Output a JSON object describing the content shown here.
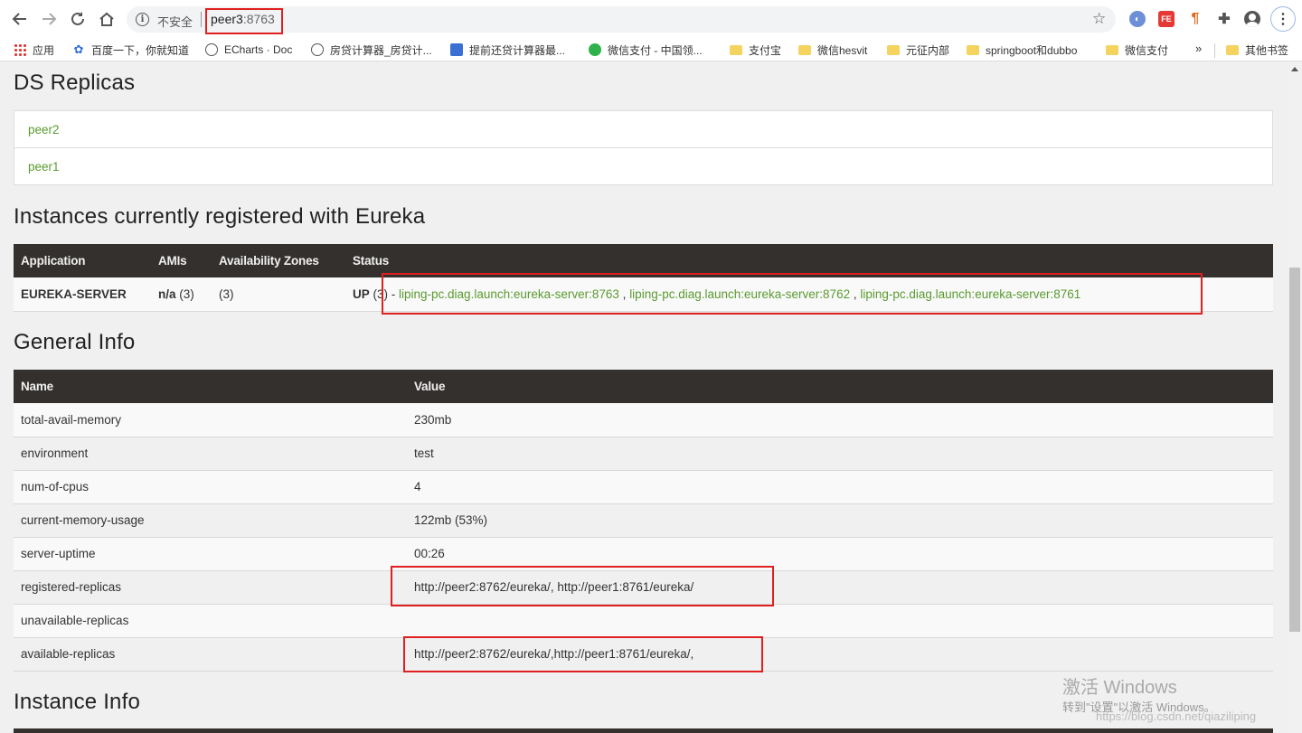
{
  "browser": {
    "security_label": "不安全",
    "url_host": "peer3",
    "url_port": ":8763",
    "menu_icon": "⋮"
  },
  "bookmarks": [
    {
      "label": "应用",
      "icon": "apps-icon"
    },
    {
      "label": "百度一下，你就知道",
      "icon": "paw-icon"
    },
    {
      "label": "ECharts · Doc",
      "icon": "globe-icon"
    },
    {
      "label": "房贷计算器_房贷计...",
      "icon": "globe-icon"
    },
    {
      "label": "提前还贷计算器最...",
      "icon": "bookmark-blue-icon"
    },
    {
      "label": "微信支付 - 中国领...",
      "icon": "wechat-icon"
    },
    {
      "label": "支付宝",
      "icon": "folder-icon"
    },
    {
      "label": "微信hesvit",
      "icon": "folder-icon"
    },
    {
      "label": "元征内部",
      "icon": "folder-icon"
    },
    {
      "label": "springboot和dubbo",
      "icon": "folder-icon"
    },
    {
      "label": "微信支付",
      "icon": "folder-icon"
    },
    {
      "label": "其他书签",
      "icon": "folder-icon"
    }
  ],
  "bookmarks_more": "»",
  "ds_replicas": {
    "title": "DS Replicas",
    "items": [
      "peer2",
      "peer1"
    ]
  },
  "instances": {
    "title": "Instances currently registered with Eureka",
    "headers": [
      "Application",
      "AMIs",
      "Availability Zones",
      "Status"
    ],
    "row": {
      "application": "EUREKA-SERVER",
      "amis_bold": "n/a",
      "amis_count": " (3)",
      "zones": "(3)",
      "status_up": "UP",
      "status_count": " (3) - ",
      "links": [
        "liping-pc.diag.launch:eureka-server:8763",
        "liping-pc.diag.launch:eureka-server:8762",
        "liping-pc.diag.launch:eureka-server:8761"
      ],
      "link_sep": " , "
    }
  },
  "general_info": {
    "title": "General Info",
    "headers": [
      "Name",
      "Value"
    ],
    "rows": [
      {
        "name": "total-avail-memory",
        "value": "230mb"
      },
      {
        "name": "environment",
        "value": "test"
      },
      {
        "name": "num-of-cpus",
        "value": "4"
      },
      {
        "name": "current-memory-usage",
        "value": "122mb (53%)"
      },
      {
        "name": "server-uptime",
        "value": "00:26"
      },
      {
        "name": "registered-replicas",
        "value": "http://peer2:8762/eureka/, http://peer1:8761/eureka/"
      },
      {
        "name": "unavailable-replicas",
        "value": ""
      },
      {
        "name": "available-replicas",
        "value": "http://peer2:8762/eureka/,http://peer1:8761/eureka/,"
      }
    ]
  },
  "instance_info": {
    "title": "Instance Info"
  },
  "watermark": {
    "line1": "激活 Windows",
    "line2": "转到\"设置\"以激活 Windows。",
    "line3": "https://blog.csdn.net/qiaziliping"
  },
  "colors": {
    "link": "#5a9a2f",
    "table_header": "#34302d",
    "highlight_box": "#e02020"
  }
}
